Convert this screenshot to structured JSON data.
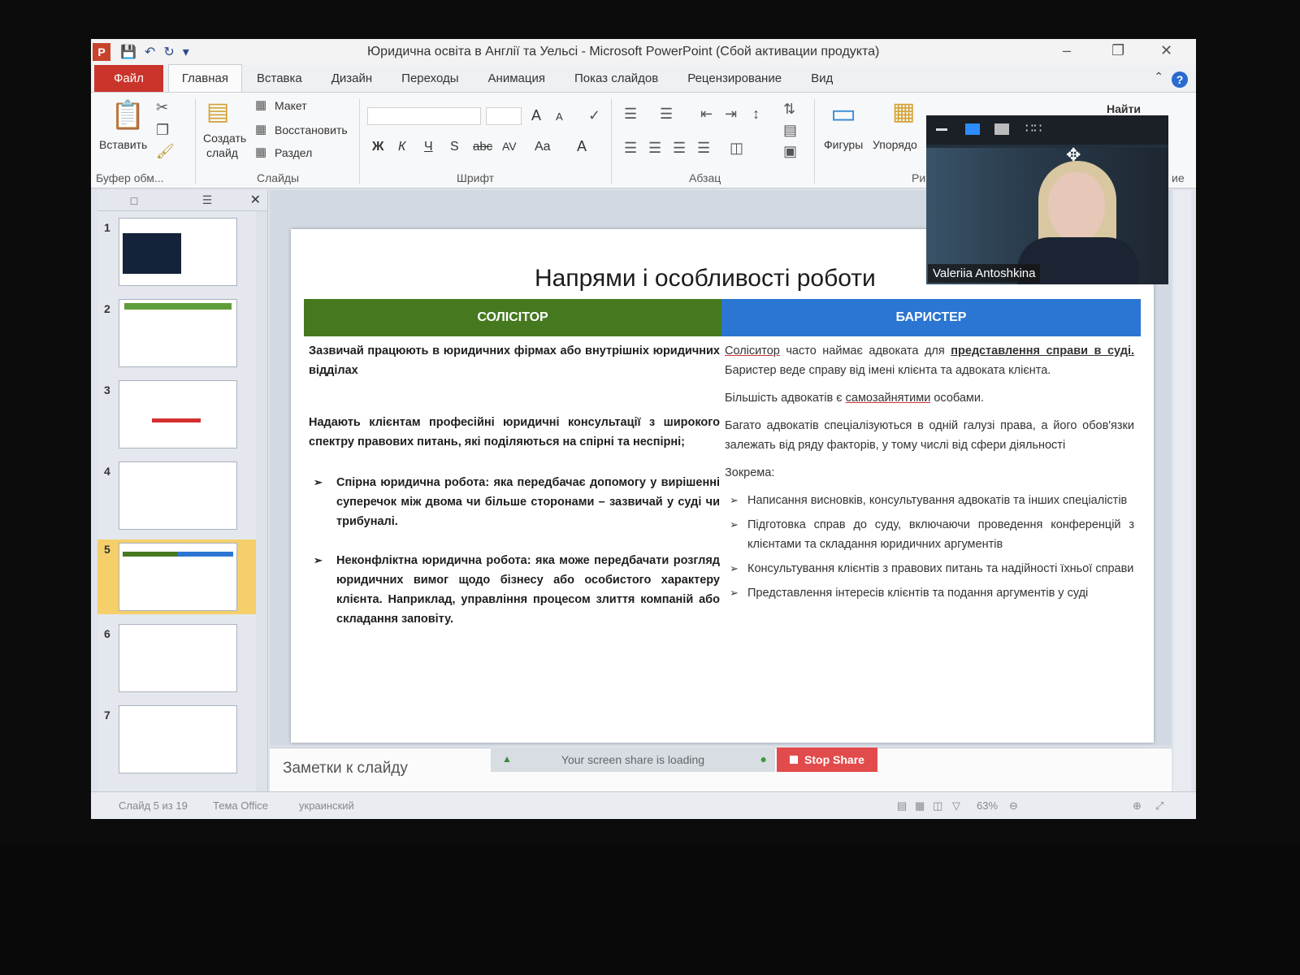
{
  "window": {
    "app_icon": "P",
    "title": "Юридична освіта в Англії та Уельсі  -  Microsoft PowerPoint (Сбой активации продукта)"
  },
  "tabs": [
    "Файл",
    "Главная",
    "Вставка",
    "Дизайн",
    "Переходы",
    "Анимация",
    "Показ слайдов",
    "Рецензирование",
    "Вид"
  ],
  "ribbon": {
    "clipboard": {
      "paste": "Вставить",
      "label": "Буфер обм..."
    },
    "slides": {
      "new_slide_line1": "Создать",
      "new_slide_line2": "слайд",
      "layout": "Макет",
      "reset": "Восстановить",
      "section": "Раздел",
      "label": "Слайды"
    },
    "font": {
      "label": "Шрифт",
      "bold": "Ж",
      "italic": "К",
      "underline": "Ч",
      "shadow": "S",
      "strike": "abc",
      "spacing": "AV",
      "case": "Aa",
      "color": "A",
      "grow": "A",
      "shrink": "A"
    },
    "paragraph": {
      "label": "Абзац"
    },
    "drawing": {
      "shapes": "Фигуры",
      "arrange": "Упорядо",
      "label_fragment": "Ри"
    },
    "editing": {
      "find": "Найти",
      "label_fragment": "ие"
    }
  },
  "panel": {
    "slides": [
      1,
      2,
      3,
      4,
      5,
      6,
      7
    ],
    "selected_slide": 5
  },
  "slide": {
    "title": "Напрями і особливості роботи",
    "solicitor_header": "СОЛІСІТОР",
    "barrister_header": "БАРИСТЕР",
    "solicitor_p1": "Зазвичай працюють в юридичних фірмах або внутрішніх юридичних відділах",
    "solicitor_p2": "Надають клієнтам професійні юридичні консультації з широкого спектру правових питань, які поділяються на спірні та неспірні;",
    "solicitor_b1": "Спірна юридична робота: яка передбачає допомогу у вирішенні суперечок між двома чи більше сторонами – зазвичай у суді чи трибуналі.",
    "solicitor_b2": "Неконфліктна юридична робота: яка може передбачати розгляд юридичних вимог щодо бізнесу або особистого характеру клієнта. Наприклад, управління процесом злиття компаній або складання заповіту.",
    "barrister_p1_a": "Соліситор",
    "barrister_p1_b": " часто наймає адвоката для ",
    "barrister_p1_c": "представлення справи в суді.",
    "barrister_p1_d": " Баристер веде справу від імені клієнта та адвоката клієнта.",
    "barrister_p2_a": "Більшість адвокатів є ",
    "barrister_p2_b": "самозайнятими",
    "barrister_p2_c": " особами.",
    "barrister_p3": "Багато адвокатів спеціалізуються в одній галузі права, а його обов'язки залежать від ряду факторів, у тому числі від сфери діяльності",
    "barrister_p4": "Зокрема:",
    "barrister_b1": "Написання висновків, консультування адвокатів та інших спеціалістів",
    "barrister_b2": "Підготовка справ до суду, включаючи проведення конференцій з клієнтами та складання юридичних аргументів",
    "barrister_b3": "Консультування клієнтів з правових питань та надійності їхньої справи",
    "barrister_b4": "Представлення інтересів клієнтів та подання аргументів у суді"
  },
  "notes": {
    "placeholder": "Заметки к слайду"
  },
  "share": {
    "loading": "Your screen share is loading",
    "stop": "Stop Share"
  },
  "status": {
    "slide": "Слайд 5 из 19",
    "theme": "Тема Office",
    "language": "украинский",
    "zoom": "63%"
  },
  "video": {
    "participant": "Valeriia Antoshkina"
  },
  "colors": {
    "solicitor": "#46791f",
    "barrister": "#2a76d2",
    "file_tab": "#c9352b",
    "stop_share": "#e24b4b"
  }
}
